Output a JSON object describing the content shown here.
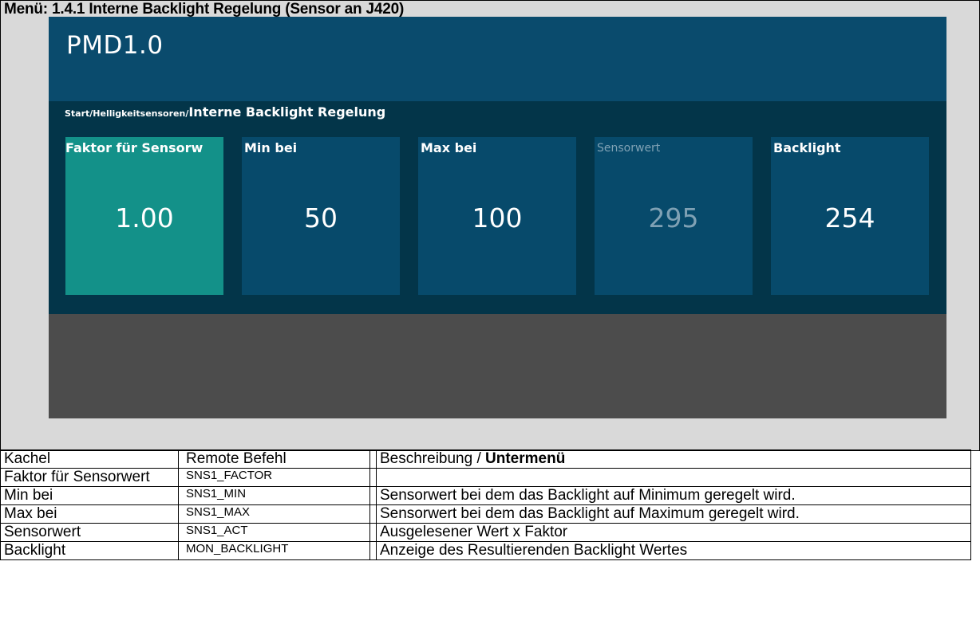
{
  "heading": "Menü: 1.4.1 Interne Backlight Regelung (Sensor an J420)",
  "screen": {
    "app_title": "PMD1.0",
    "breadcrumb": {
      "path": "Start/Helligkeitsensoren/",
      "current": "Interne Backlight Regelung"
    },
    "tiles": [
      {
        "label": "Faktor für Sensorw",
        "value": "1.00",
        "state": "active"
      },
      {
        "label": "Min bei",
        "value": "50",
        "state": "normal"
      },
      {
        "label": "Max bei",
        "value": "100",
        "state": "normal"
      },
      {
        "label": "Sensorwert",
        "value": "295",
        "state": "disabled"
      },
      {
        "label": "Backlight",
        "value": "254",
        "state": "normal"
      }
    ]
  },
  "table": {
    "headers": {
      "col1": "Kachel",
      "col2": "Remote Befehl",
      "col3_prefix": "Beschreibung / ",
      "col3_bold": "Untermenü"
    },
    "rows": [
      {
        "kachel": "Faktor für Sensorwert",
        "remote": "SNS1_FACTOR",
        "beschreibung": ""
      },
      {
        "kachel": "Min bei",
        "remote": "SNS1_MIN",
        "beschreibung": "Sensorwert bei dem das Backlight auf Minimum geregelt wird."
      },
      {
        "kachel": "Max bei",
        "remote": "SNS1_MAX",
        "beschreibung": "Sensorwert bei dem das Backlight auf Maximum geregelt wird."
      },
      {
        "kachel": "Sensorwert",
        "remote": "SNS1_ACT",
        "beschreibung": "Ausgelesener Wert x Faktor"
      },
      {
        "kachel": "Backlight",
        "remote": "MON_BACKLIGHT",
        "beschreibung": "Anzeige des Resultierenden Backlight Wertes"
      }
    ]
  },
  "colors": {
    "header_bg": "#0a4b6d",
    "tile_area_bg": "#033549",
    "tile_bg": "#074a6b",
    "tile_active_bg": "#139189",
    "tile_disabled_text": "#7fa1b4",
    "footer_bg": "#4c4c4c"
  }
}
